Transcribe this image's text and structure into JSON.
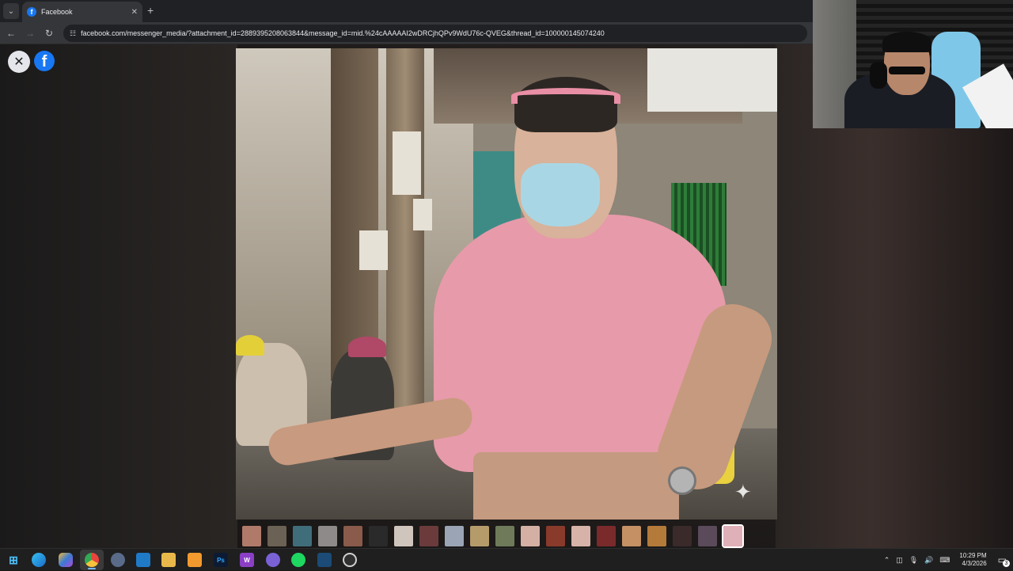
{
  "browser": {
    "tab": {
      "title": "Facebook",
      "favicon": "f",
      "close": "✕"
    },
    "new_tab": "+",
    "url": "facebook.com/messenger_media/?attachment_id=2889395208063844&message_id=mid.%24cAAAAAI2wDRCjhQPv9WdU76c-QVEG&thread_id=100000145074240"
  },
  "viewer": {
    "close": "✕",
    "fb_logo": "f",
    "thumbnail_count": 21,
    "active_thumbnail": 20,
    "thumb_colors": [
      "#b07a6a",
      "#6b6154",
      "#3f6e7a",
      "#8e8a8a",
      "#8a5a4a",
      "#2a2a2a",
      "#cfc5bc",
      "#6b3b3b",
      "#9aa4b4",
      "#b59a6a",
      "#6e7a5a",
      "#d4b0a4",
      "#8a3a2a",
      "#d6b2a8",
      "#7a2a2a",
      "#c49064",
      "#b47a3a",
      "#3a2a2a",
      "#5a4a5a",
      "#e0b0b8"
    ]
  },
  "taskbar": {
    "icons": [
      "windows-icon",
      "edge-icon",
      "copilot-icon",
      "chrome-icon",
      "steam-helper-icon",
      "vscode-icon",
      "file-explorer-icon",
      "sublime-icon",
      "photoshop-icon",
      "app-w-icon",
      "discord-icon",
      "spotify-icon",
      "steam-icon",
      "obs-icon"
    ],
    "labels": {
      "photoshop": "Ps",
      "w": "W"
    },
    "time": "10:29 PM",
    "date": "4/3/2026",
    "notification_count": "3"
  }
}
